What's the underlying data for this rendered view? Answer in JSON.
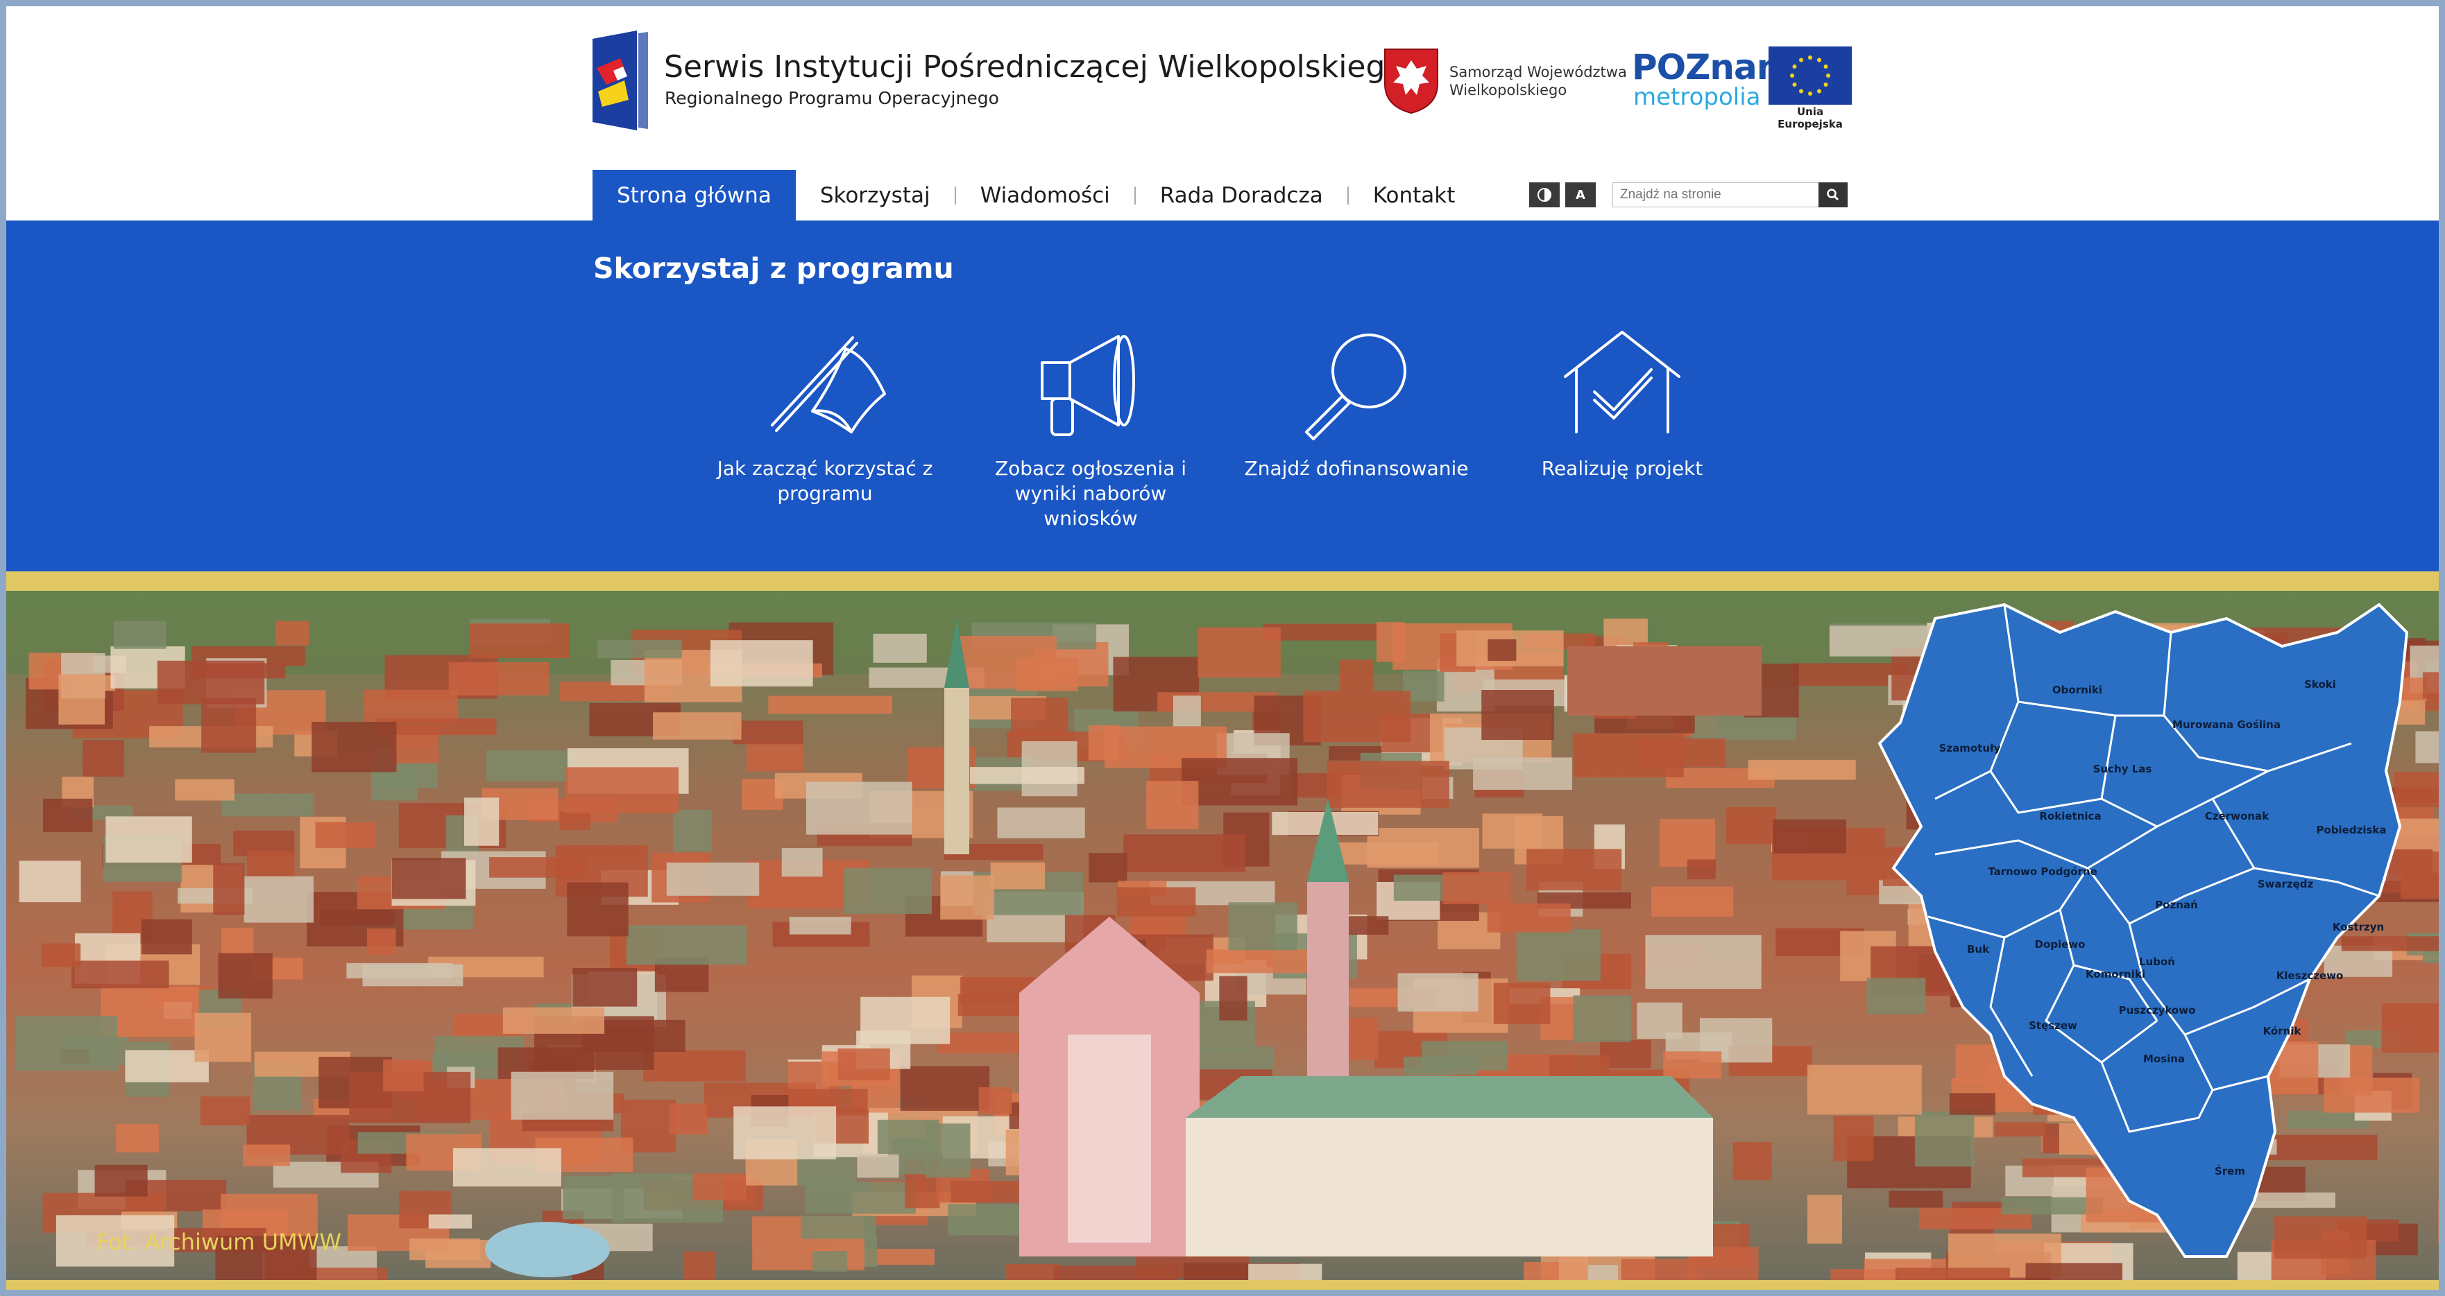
{
  "header": {
    "title": "Serwis Instytucji Pośredniczącej Wielkopolskiego",
    "subtitle": "Regionalnego Programu Operacyjnego",
    "samorzad_line1": "Samorząd Województwa",
    "samorzad_line2": "Wielkopolskiego",
    "poznan_top": "POZnan",
    "poznan_star": "*",
    "poznan_bottom": "metropolia",
    "eu_label": "Unia Europejska"
  },
  "nav": {
    "items": [
      {
        "label": "Strona główna",
        "active": true
      },
      {
        "label": "Skorzystaj"
      },
      {
        "label": "Wiadomości"
      },
      {
        "label": "Rada Doradcza"
      },
      {
        "label": "Kontakt"
      }
    ]
  },
  "tools": {
    "contrast_icon": "contrast-icon",
    "font_size_label": "A",
    "search_placeholder": "Znajdź na stronie",
    "search_icon": "search-icon"
  },
  "band": {
    "title": "Skorzystaj z programu",
    "tiles": [
      {
        "label_line1": "Jak zacząć korzystać z",
        "label_line2": "programu",
        "icon": "flag-icon"
      },
      {
        "label_line1": "Zobacz ogłoszenia i",
        "label_line2": "wyniki naborów wniosków",
        "icon": "megaphone-icon"
      },
      {
        "label_line1": "Znajdź dofinansowanie",
        "label_line2": "",
        "icon": "magnifier-icon"
      },
      {
        "label_line1": "Realizuję projekt",
        "label_line2": "",
        "icon": "house-check-icon"
      }
    ]
  },
  "hero": {
    "caption": "Fot. Archiwum UMWW",
    "map_labels": [
      "Oborniki",
      "Skoki",
      "Szamotuły",
      "Murowana Goślina",
      "Suchy Las",
      "Rokietnica",
      "Czerwonak",
      "Pobiedziska",
      "Tarnowo Podgórne",
      "Poznań",
      "Swarzędz",
      "Kostrzyn",
      "Buk",
      "Dopiewo",
      "Luboń",
      "Komorniki",
      "Kleszczewo",
      "Puszczykowo",
      "Stęszew",
      "Mosina",
      "Kórnik",
      "Śrem"
    ]
  },
  "colors": {
    "brand_blue": "#1a56c4",
    "gold": "#e1c764",
    "map_blue": "#2a6fc4"
  }
}
